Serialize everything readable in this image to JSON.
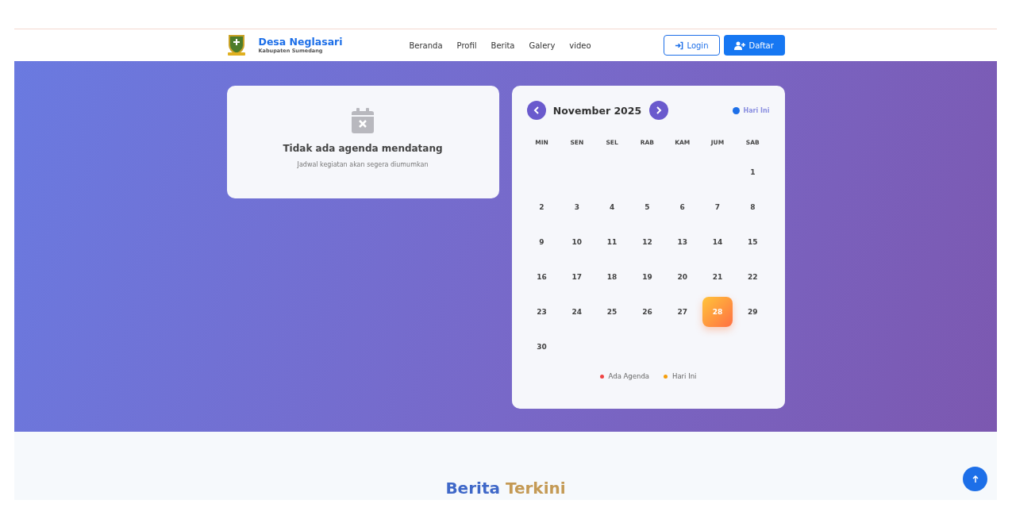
{
  "brand": {
    "name": "Desa Neglasari",
    "subtitle": "Kabupaten Sumedang"
  },
  "nav": [
    {
      "label": "Beranda"
    },
    {
      "label": "Profil"
    },
    {
      "label": "Berita"
    },
    {
      "label": "Galery"
    },
    {
      "label": "video"
    }
  ],
  "auth": {
    "login": "Login",
    "register": "Daftar"
  },
  "agenda": {
    "title": "Tidak ada agenda mendatang",
    "subtitle": "Jadwal kegiatan akan segera diumumkan"
  },
  "calendar": {
    "month": "November 2025",
    "today_label": "Hari Ini",
    "weekdays": [
      "MIN",
      "SEN",
      "SEL",
      "RAB",
      "KAM",
      "JUM",
      "SAB"
    ],
    "weeks": [
      {
        "kind": "month_start",
        "days": [
          {
            "day": "1",
            "today": false
          }
        ]
      },
      {
        "kind": "week",
        "days": [
          {
            "day": "2",
            "today": false
          },
          {
            "day": "3",
            "today": false
          },
          {
            "day": "4",
            "today": false
          },
          {
            "day": "5",
            "today": false
          },
          {
            "day": "6",
            "today": false
          },
          {
            "day": "7",
            "today": false
          },
          {
            "day": "8",
            "today": false
          }
        ]
      },
      {
        "kind": "week",
        "days": [
          {
            "day": "9",
            "today": false
          },
          {
            "day": "10",
            "today": false
          },
          {
            "day": "11",
            "today": false
          },
          {
            "day": "12",
            "today": false
          },
          {
            "day": "13",
            "today": false
          },
          {
            "day": "14",
            "today": false
          },
          {
            "day": "15",
            "today": false
          }
        ]
      },
      {
        "kind": "week",
        "days": [
          {
            "day": "16",
            "today": false
          },
          {
            "day": "17",
            "today": false
          },
          {
            "day": "18",
            "today": false
          },
          {
            "day": "19",
            "today": false
          },
          {
            "day": "20",
            "today": false
          },
          {
            "day": "21",
            "today": false
          },
          {
            "day": "22",
            "today": false
          }
        ]
      },
      {
        "kind": "week",
        "days": [
          {
            "day": "23",
            "today": false
          },
          {
            "day": "24",
            "today": false
          },
          {
            "day": "25",
            "today": false
          },
          {
            "day": "26",
            "today": false
          },
          {
            "day": "27",
            "today": false
          },
          {
            "day": "28",
            "today": true
          },
          {
            "day": "29",
            "today": false
          }
        ]
      },
      {
        "kind": "week",
        "days": [
          {
            "day": "30",
            "today": false
          }
        ]
      }
    ],
    "legend": [
      {
        "label": "Ada Agenda",
        "color": "#ef4444"
      },
      {
        "label": "Hari Ini",
        "color": "#f59e0b"
      }
    ]
  },
  "news": {
    "heading_first": "Berita",
    "heading_second": "Terkini"
  }
}
